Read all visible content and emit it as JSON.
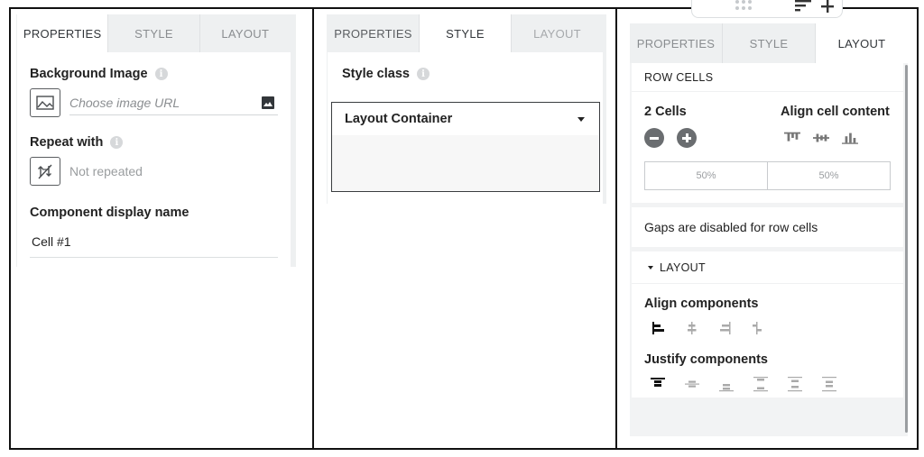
{
  "tabs": [
    "PROPERTIES",
    "STYLE",
    "LAYOUT"
  ],
  "panel_properties": {
    "active_tab": "PROPERTIES",
    "background_image": {
      "label": "Background Image",
      "placeholder": "Choose image URL"
    },
    "repeat_with": {
      "label": "Repeat with",
      "value": "Not repeated"
    },
    "display_name": {
      "label": "Component display name",
      "value": "Cell #1"
    }
  },
  "panel_style": {
    "active_tab": "STYLE",
    "style_class_label": "Style class",
    "dropdown_value": "Layout Container"
  },
  "panel_layout": {
    "active_tab": "LAYOUT",
    "row_cells_header": "ROW CELLS",
    "cells_count": "2 Cells",
    "align_cell_content_label": "Align cell content",
    "cell_widths": [
      "50%",
      "50%"
    ],
    "gaps_note": "Gaps are disabled for row cells",
    "layout_section": "LAYOUT",
    "align_components_label": "Align components",
    "justify_components_label": "Justify components"
  },
  "icons": {
    "info": "i"
  }
}
